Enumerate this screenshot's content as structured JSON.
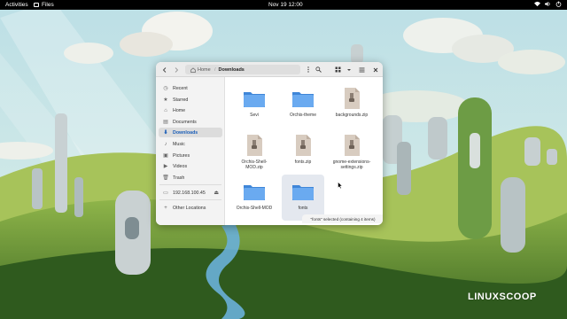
{
  "topbar": {
    "activities": "Activities",
    "app_name": "Files",
    "clock": "Nov 19  12:00"
  },
  "window": {
    "path_home": "Home",
    "path_current": "Downloads",
    "sidebar": {
      "items": [
        {
          "label": "Recent",
          "icon": "clock-icon"
        },
        {
          "label": "Starred",
          "icon": "star-icon"
        },
        {
          "label": "Home",
          "icon": "home-icon"
        },
        {
          "label": "Documents",
          "icon": "document-icon"
        },
        {
          "label": "Downloads",
          "icon": "download-icon",
          "active": true
        },
        {
          "label": "Music",
          "icon": "music-icon"
        },
        {
          "label": "Pictures",
          "icon": "picture-icon"
        },
        {
          "label": "Videos",
          "icon": "video-icon"
        },
        {
          "label": "Trash",
          "icon": "trash-icon"
        },
        {
          "label": "192.168.100.45",
          "icon": "network-icon"
        },
        {
          "label": "Other Locations",
          "icon": "plus-icon"
        }
      ]
    },
    "files": [
      {
        "name": "Sevi",
        "type": "folder"
      },
      {
        "name": "Orchis-theme",
        "type": "folder"
      },
      {
        "name": "backgrounds.zip",
        "type": "zip"
      },
      {
        "name": "Orchis-Shell-MOD.zip",
        "type": "zip"
      },
      {
        "name": "fonts.zip",
        "type": "zip"
      },
      {
        "name": "gnome-extensions-settings.zip",
        "type": "zip"
      },
      {
        "name": "Orchis-Shell-MOD",
        "type": "folder"
      },
      {
        "name": "fonts",
        "type": "folder",
        "selected": true
      }
    ],
    "status": "\"fonts\" selected (containing 4 items)"
  },
  "watermark": "LINUXSCOOP",
  "colors": {
    "accent": "#1c5fb8",
    "folder": "#5a9ee6",
    "topbar": "#000000"
  }
}
